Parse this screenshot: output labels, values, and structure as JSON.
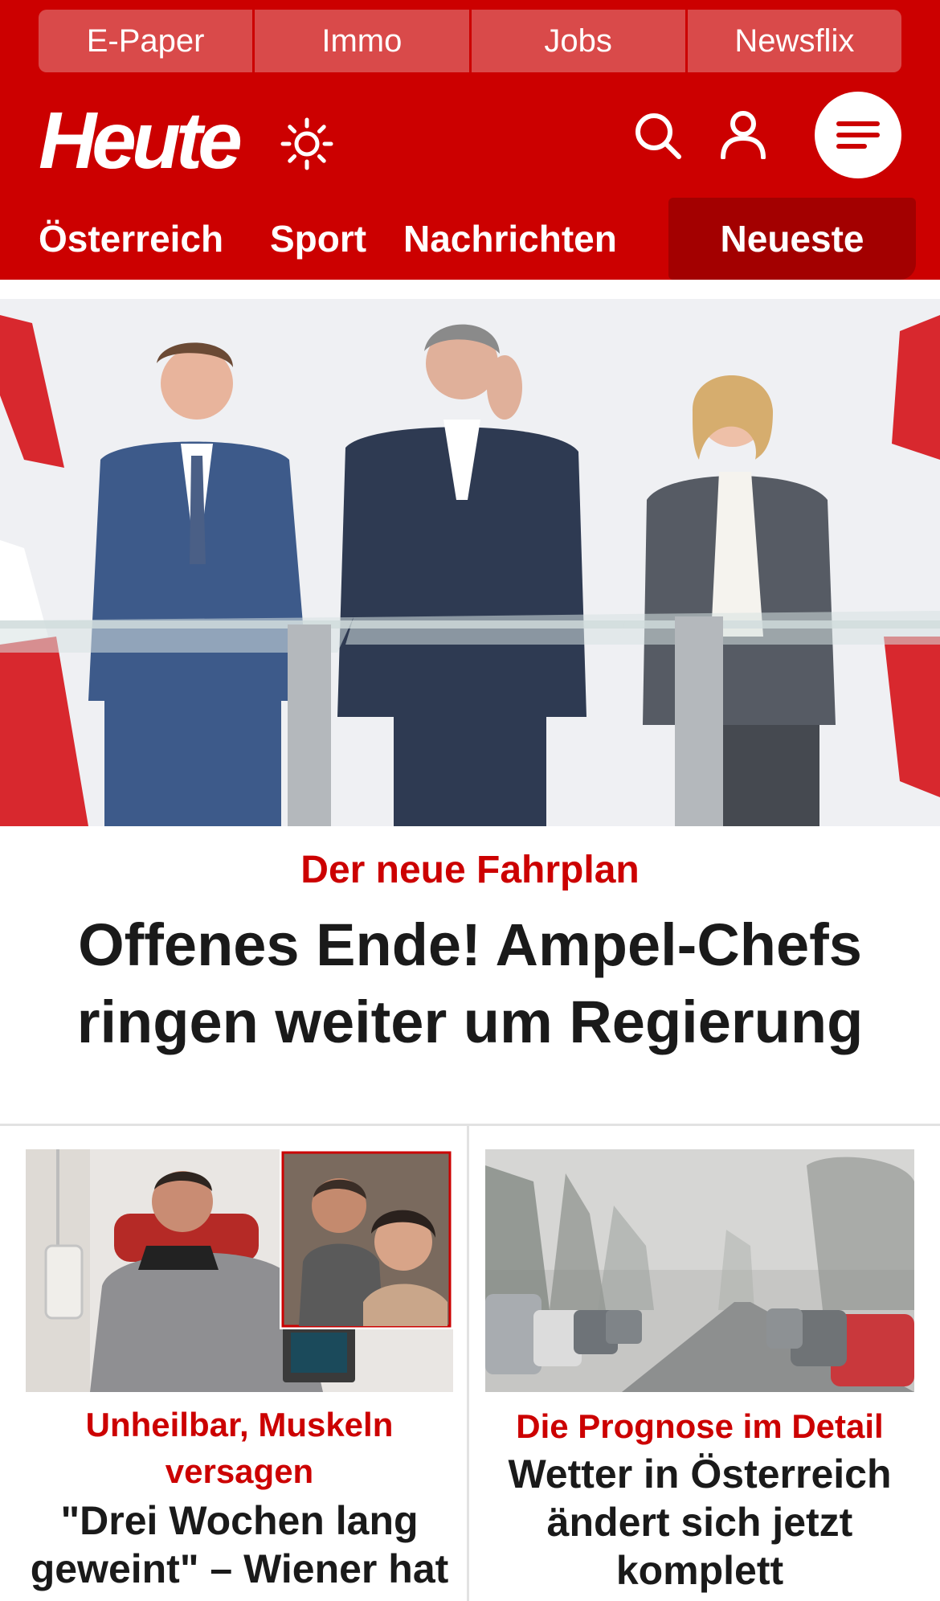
{
  "topnav": {
    "items": [
      {
        "label": "E-Paper"
      },
      {
        "label": "Immo"
      },
      {
        "label": "Jobs"
      },
      {
        "label": "Newsflix"
      }
    ]
  },
  "header": {
    "logo_text": "Heute",
    "icons": [
      "sun-icon",
      "search-icon",
      "user-icon",
      "menu-icon"
    ]
  },
  "secnav": {
    "items": [
      {
        "label": "Österreich"
      },
      {
        "label": "Sport"
      },
      {
        "label": "Nachrichten"
      },
      {
        "label": "Neueste"
      }
    ],
    "active": "Neueste"
  },
  "hero": {
    "kicker": "Der neue Fahrplan",
    "headline": "Offenes Ende! Ampel-Chefs ringen weiter um Regierung"
  },
  "cards": [
    {
      "kicker": "Unheilbar, Muskeln versagen",
      "title": "\"Drei Wochen lang geweint\" – Wiener hat"
    },
    {
      "kicker": "Die Prognose im Detail",
      "title": "Wetter in Österreich ändert sich jetzt komplett"
    }
  ],
  "colors": {
    "brand_red": "#cc0000",
    "active_tab": "#a30000",
    "topnav_button": "#d94a4a",
    "headline_text": "#1a1a1a"
  }
}
